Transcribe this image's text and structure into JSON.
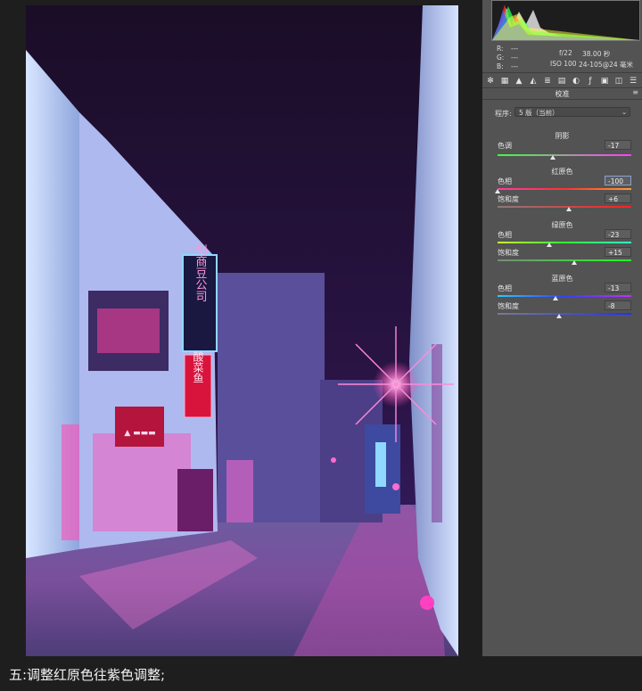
{
  "camera_info": {
    "r_label": "R:",
    "r_value": "---",
    "g_label": "G:",
    "g_value": "---",
    "b_label": "B:",
    "b_value": "---",
    "aperture": "f/22",
    "shutter": "38.00 秒",
    "iso": "ISO 100",
    "lens": "24-105@24 毫米"
  },
  "toolbar": {
    "icons": [
      "aperture-icon",
      "histogram-icon",
      "mountain-icon",
      "tone-curve-icon",
      "detail-icon",
      "hsl-icon",
      "split-toning-icon",
      "lens-icon",
      "fx-icon",
      "camera-calibration-icon",
      "presets-icon"
    ]
  },
  "section": {
    "title": "校准",
    "menu_glyph": "≡"
  },
  "program": {
    "label": "程序:",
    "value": "5 版（当前）",
    "arrow": "⌄"
  },
  "shadow": {
    "title": "阴影",
    "tint_label": "色调",
    "tint_value": "-17",
    "tint_level": -17
  },
  "red_primary": {
    "title": "红原色",
    "hue_label": "色相",
    "hue_value": "-100",
    "hue_level": -100,
    "saturation_label": "饱和度",
    "saturation_value": "+6",
    "saturation_level": 6
  },
  "green_primary": {
    "title": "绿原色",
    "hue_label": "色相",
    "hue_value": "-23",
    "hue_level": -23,
    "saturation_label": "饱和度",
    "saturation_value": "+15",
    "saturation_level": 15
  },
  "blue_primary": {
    "title": "蓝原色",
    "hue_label": "色相",
    "hue_value": "-13",
    "hue_level": -13,
    "saturation_label": "饱和度",
    "saturation_value": "-8",
    "saturation_level": -8
  },
  "photo_signs": {
    "vertical_sign": "剑商豆公司",
    "red_sign": "酸菜鱼",
    "shop_sign": "▲ ▬▬▬"
  },
  "caption": "五:调整红原色往紫色调整;",
  "colors": {
    "panel_bg": "#535353",
    "page_bg": "#1e1e1e",
    "sky": "#1b0f2e",
    "neon_pink": "#ff3fb0",
    "neon_blue": "#8fd8ff"
  }
}
